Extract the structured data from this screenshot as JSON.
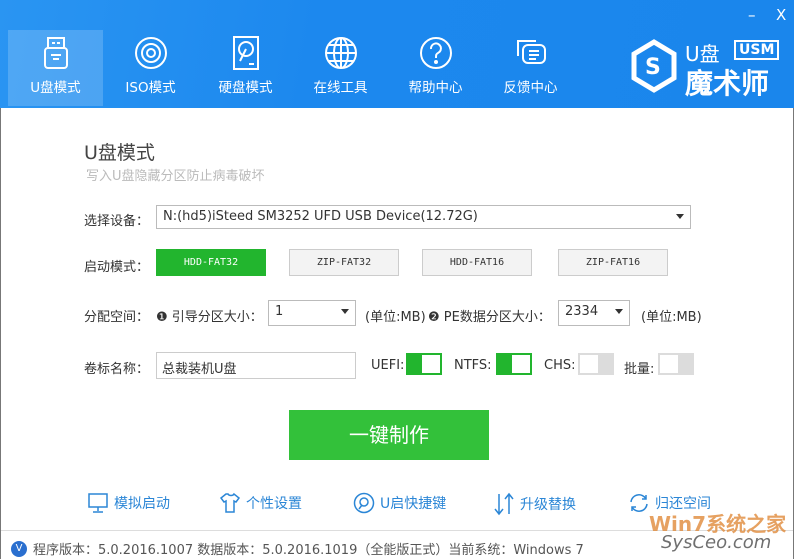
{
  "window": {
    "minimize": "–",
    "close": "X"
  },
  "tabs": [
    {
      "label": "U盘模式",
      "icon": "usb-drive-icon"
    },
    {
      "label": "ISO模式",
      "icon": "disc-icon"
    },
    {
      "label": "硬盘模式",
      "icon": "hard-disk-icon"
    },
    {
      "label": "在线工具",
      "icon": "globe-icon"
    },
    {
      "label": "帮助中心",
      "icon": "question-icon"
    },
    {
      "label": "反馈中心",
      "icon": "chat-icon"
    }
  ],
  "logo": {
    "line1": "U盘",
    "badge": "USM",
    "line2": "魔术师"
  },
  "page": {
    "title": "U盘模式",
    "subtitle": "写入U盘隐藏分区防止病毒破坏"
  },
  "device": {
    "label": "选择设备：",
    "value": "N:(hd5)iSteed SM3252 UFD USB Device(12.72G)"
  },
  "boot": {
    "label": "启动模式：",
    "modes": [
      "HDD-FAT32",
      "ZIP-FAT32",
      "HDD-FAT16",
      "ZIP-FAT16"
    ],
    "selected": "HDD-FAT32"
  },
  "alloc": {
    "label": "分配空间：",
    "boot_size_label": "❶ 引导分区大小：",
    "boot_size": "1",
    "unit1": "(单位:MB)",
    "pe_size_label": "❷ PE数据分区大小：",
    "pe_size": "2334",
    "unit2": "(单位:MB)"
  },
  "volume": {
    "label": "卷标名称：",
    "value": "总裁装机U盘"
  },
  "toggles": [
    {
      "label": "UEFI:",
      "on": true
    },
    {
      "label": "NTFS:",
      "on": true
    },
    {
      "label": "CHS:",
      "on": false
    },
    {
      "label": "批量:",
      "on": false
    }
  ],
  "make_button": "一键制作",
  "tools": [
    {
      "label": "模拟启动",
      "icon": "monitor-icon"
    },
    {
      "label": "个性设置",
      "icon": "shirt-icon"
    },
    {
      "label": "U启快捷键",
      "icon": "search-key-icon"
    },
    {
      "label": "升级替换",
      "icon": "up-down-arrows-icon"
    },
    {
      "label": "归还空间",
      "icon": "refresh-icon"
    }
  ],
  "footer": {
    "badge": "V",
    "text": "程序版本：5.0.2016.1007  数据版本：5.0.2016.1019（全能版正式）当前系统：Windows 7"
  },
  "watermark": {
    "line1": "Win7系统之家",
    "line2": "SysCeo.com"
  }
}
